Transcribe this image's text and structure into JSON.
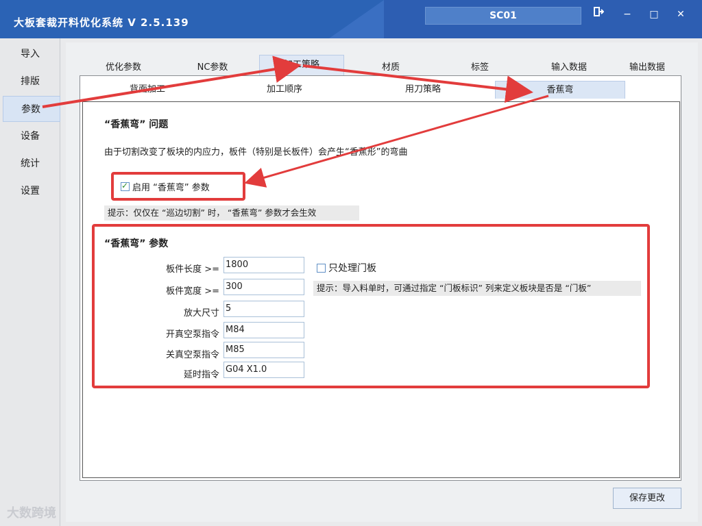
{
  "window": {
    "title": "大板套裁开料优化系统  V 2.5.139",
    "station": "SC01",
    "buttons": {
      "exit_icon": "exit-icon",
      "minimize": "−",
      "maximize": "□",
      "close": "✕"
    }
  },
  "sidebar": {
    "items": [
      {
        "label": "导入",
        "active": false
      },
      {
        "label": "排版",
        "active": false
      },
      {
        "label": "参数",
        "active": true
      },
      {
        "label": "设备",
        "active": false
      },
      {
        "label": "统计",
        "active": false
      },
      {
        "label": "设置",
        "active": false
      }
    ]
  },
  "top_tabs": [
    {
      "label": "优化参数",
      "active": false
    },
    {
      "label": "NC参数",
      "active": false
    },
    {
      "label": "加工策略",
      "active": true
    },
    {
      "label": "材质",
      "active": false
    },
    {
      "label": "标签",
      "active": false
    },
    {
      "label": "输入数据",
      "active": false
    },
    {
      "label": "输出数据",
      "active": false
    }
  ],
  "sub_tabs": [
    {
      "label": "背面加工",
      "active": false
    },
    {
      "label": "加工顺序",
      "active": false
    },
    {
      "label": "用刀策略",
      "active": false
    },
    {
      "label": "香蕉弯",
      "active": true
    }
  ],
  "problem": {
    "title": "“香蕉弯” 问题",
    "description": "由于切割改变了板块的内应力，板件（特别是长板件）会产生“香蕉形”的弯曲",
    "enable_label": "启用 “香蕉弯” 参数",
    "enable_checked": true,
    "hint": "提示：仅仅在 “巡边切割” 时， “香蕉弯” 参数才会生效"
  },
  "params": {
    "title": "“香蕉弯” 参数",
    "fields": [
      {
        "label": "板件长度 >=",
        "value": "1800"
      },
      {
        "label": "板件宽度 >=",
        "value": "300"
      },
      {
        "label": "放大尺寸",
        "value": "5"
      },
      {
        "label": "开真空泵指令",
        "value": "M84"
      },
      {
        "label": "关真空泵指令",
        "value": "M85"
      },
      {
        "label": "延时指令",
        "value": "G04 X1.0"
      }
    ],
    "door_only_label": "只处理门板",
    "door_only_checked": false,
    "door_hint": "提示：导入料单时，可通过指定 “门板标识” 列来定义板块是否是 “门板”"
  },
  "footer": {
    "save_label": "保存更改"
  },
  "watermark": "大数跨境",
  "colors": {
    "titlebar": "#2b63b5",
    "annotation_red": "#e23c3c",
    "active_tab": "#dfe8f5"
  }
}
